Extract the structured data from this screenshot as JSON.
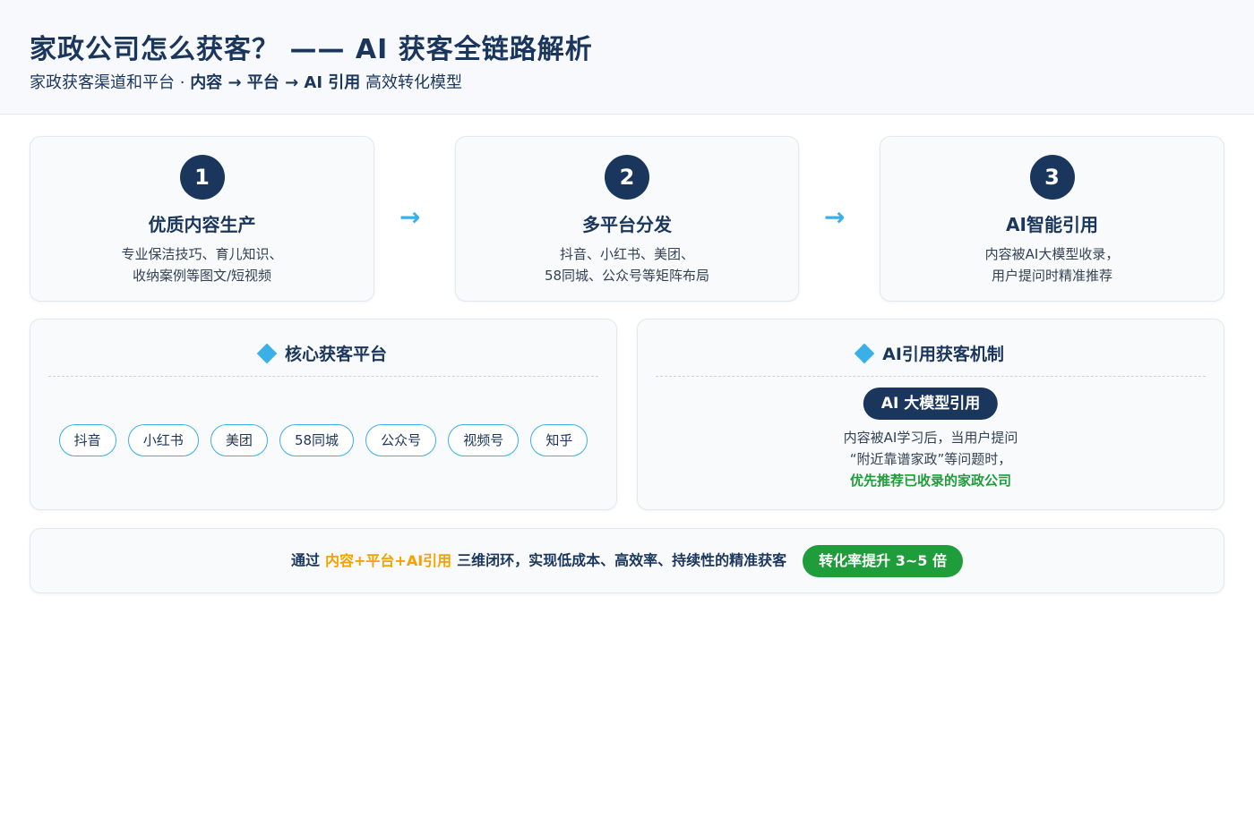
{
  "header": {
    "title": "家政公司怎么获客？ —— AI 获客全链路解析",
    "subtitle_prefix": "家政获客渠道和平台 ·",
    "subtitle_strong": "内容 → 平台 → AI 引用",
    "subtitle_suffix": "高效转化模型"
  },
  "steps": [
    {
      "num": "1",
      "title": "优质内容生产",
      "line1": "专业保洁技巧、育儿知识、",
      "line2": "收纳案例等图文/短视频"
    },
    {
      "num": "2",
      "title": "多平台分发",
      "line1": "抖音、小红书、美团、",
      "line2": "58同城、公众号等矩阵布局"
    },
    {
      "num": "3",
      "title": "AI智能引用",
      "line1": "内容被AI大模型收录，",
      "line2": "用户提问时精准推荐"
    }
  ],
  "arrow": "→",
  "platforms": {
    "title": "核心获客平台",
    "tags": [
      "抖音",
      "小红书",
      "美团",
      "58同城",
      "公众号",
      "视频号",
      "知乎"
    ]
  },
  "ai_mechanism": {
    "title": "AI引用获客机制",
    "badge": "AI 大模型引用",
    "line1": "内容被AI学习后，当用户提问",
    "line2": "“附近靠谱家政”等问题时，",
    "line3": "优先推荐已收录的家政公司"
  },
  "summary": {
    "prefix": "通过",
    "highlight": "内容+平台+AI引用",
    "suffix": "三维闭环，实现低成本、高效率、持续性的精准获客",
    "badge": "转化率提升 3~5 倍"
  },
  "colors": {
    "navy": "#1b365d",
    "accent_blue": "#3bb0e8",
    "green": "#1f9d3a",
    "orange": "#f5a100"
  }
}
